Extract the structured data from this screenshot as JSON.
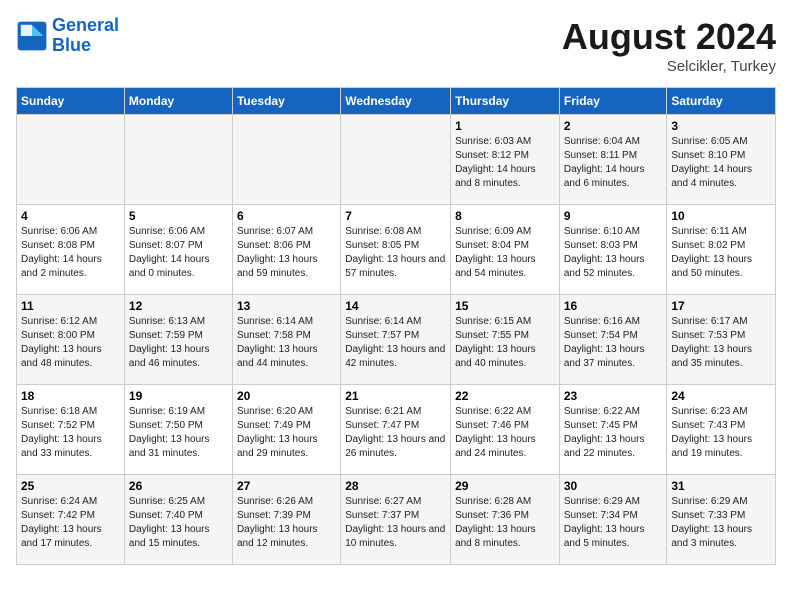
{
  "header": {
    "logo_line1": "General",
    "logo_line2": "Blue",
    "month_year": "August 2024",
    "location": "Selcikler, Turkey"
  },
  "days_of_week": [
    "Sunday",
    "Monday",
    "Tuesday",
    "Wednesday",
    "Thursday",
    "Friday",
    "Saturday"
  ],
  "weeks": [
    [
      {
        "day": "",
        "info": ""
      },
      {
        "day": "",
        "info": ""
      },
      {
        "day": "",
        "info": ""
      },
      {
        "day": "",
        "info": ""
      },
      {
        "day": "1",
        "info": "Sunrise: 6:03 AM\nSunset: 8:12 PM\nDaylight: 14 hours\nand 8 minutes."
      },
      {
        "day": "2",
        "info": "Sunrise: 6:04 AM\nSunset: 8:11 PM\nDaylight: 14 hours\nand 6 minutes."
      },
      {
        "day": "3",
        "info": "Sunrise: 6:05 AM\nSunset: 8:10 PM\nDaylight: 14 hours\nand 4 minutes."
      }
    ],
    [
      {
        "day": "4",
        "info": "Sunrise: 6:06 AM\nSunset: 8:08 PM\nDaylight: 14 hours\nand 2 minutes."
      },
      {
        "day": "5",
        "info": "Sunrise: 6:06 AM\nSunset: 8:07 PM\nDaylight: 14 hours\nand 0 minutes."
      },
      {
        "day": "6",
        "info": "Sunrise: 6:07 AM\nSunset: 8:06 PM\nDaylight: 13 hours\nand 59 minutes."
      },
      {
        "day": "7",
        "info": "Sunrise: 6:08 AM\nSunset: 8:05 PM\nDaylight: 13 hours\nand 57 minutes."
      },
      {
        "day": "8",
        "info": "Sunrise: 6:09 AM\nSunset: 8:04 PM\nDaylight: 13 hours\nand 54 minutes."
      },
      {
        "day": "9",
        "info": "Sunrise: 6:10 AM\nSunset: 8:03 PM\nDaylight: 13 hours\nand 52 minutes."
      },
      {
        "day": "10",
        "info": "Sunrise: 6:11 AM\nSunset: 8:02 PM\nDaylight: 13 hours\nand 50 minutes."
      }
    ],
    [
      {
        "day": "11",
        "info": "Sunrise: 6:12 AM\nSunset: 8:00 PM\nDaylight: 13 hours\nand 48 minutes."
      },
      {
        "day": "12",
        "info": "Sunrise: 6:13 AM\nSunset: 7:59 PM\nDaylight: 13 hours\nand 46 minutes."
      },
      {
        "day": "13",
        "info": "Sunrise: 6:14 AM\nSunset: 7:58 PM\nDaylight: 13 hours\nand 44 minutes."
      },
      {
        "day": "14",
        "info": "Sunrise: 6:14 AM\nSunset: 7:57 PM\nDaylight: 13 hours\nand 42 minutes."
      },
      {
        "day": "15",
        "info": "Sunrise: 6:15 AM\nSunset: 7:55 PM\nDaylight: 13 hours\nand 40 minutes."
      },
      {
        "day": "16",
        "info": "Sunrise: 6:16 AM\nSunset: 7:54 PM\nDaylight: 13 hours\nand 37 minutes."
      },
      {
        "day": "17",
        "info": "Sunrise: 6:17 AM\nSunset: 7:53 PM\nDaylight: 13 hours\nand 35 minutes."
      }
    ],
    [
      {
        "day": "18",
        "info": "Sunrise: 6:18 AM\nSunset: 7:52 PM\nDaylight: 13 hours\nand 33 minutes."
      },
      {
        "day": "19",
        "info": "Sunrise: 6:19 AM\nSunset: 7:50 PM\nDaylight: 13 hours\nand 31 minutes."
      },
      {
        "day": "20",
        "info": "Sunrise: 6:20 AM\nSunset: 7:49 PM\nDaylight: 13 hours\nand 29 minutes."
      },
      {
        "day": "21",
        "info": "Sunrise: 6:21 AM\nSunset: 7:47 PM\nDaylight: 13 hours\nand 26 minutes."
      },
      {
        "day": "22",
        "info": "Sunrise: 6:22 AM\nSunset: 7:46 PM\nDaylight: 13 hours\nand 24 minutes."
      },
      {
        "day": "23",
        "info": "Sunrise: 6:22 AM\nSunset: 7:45 PM\nDaylight: 13 hours\nand 22 minutes."
      },
      {
        "day": "24",
        "info": "Sunrise: 6:23 AM\nSunset: 7:43 PM\nDaylight: 13 hours\nand 19 minutes."
      }
    ],
    [
      {
        "day": "25",
        "info": "Sunrise: 6:24 AM\nSunset: 7:42 PM\nDaylight: 13 hours\nand 17 minutes."
      },
      {
        "day": "26",
        "info": "Sunrise: 6:25 AM\nSunset: 7:40 PM\nDaylight: 13 hours\nand 15 minutes."
      },
      {
        "day": "27",
        "info": "Sunrise: 6:26 AM\nSunset: 7:39 PM\nDaylight: 13 hours\nand 12 minutes."
      },
      {
        "day": "28",
        "info": "Sunrise: 6:27 AM\nSunset: 7:37 PM\nDaylight: 13 hours\nand 10 minutes."
      },
      {
        "day": "29",
        "info": "Sunrise: 6:28 AM\nSunset: 7:36 PM\nDaylight: 13 hours\nand 8 minutes."
      },
      {
        "day": "30",
        "info": "Sunrise: 6:29 AM\nSunset: 7:34 PM\nDaylight: 13 hours\nand 5 minutes."
      },
      {
        "day": "31",
        "info": "Sunrise: 6:29 AM\nSunset: 7:33 PM\nDaylight: 13 hours\nand 3 minutes."
      }
    ]
  ]
}
